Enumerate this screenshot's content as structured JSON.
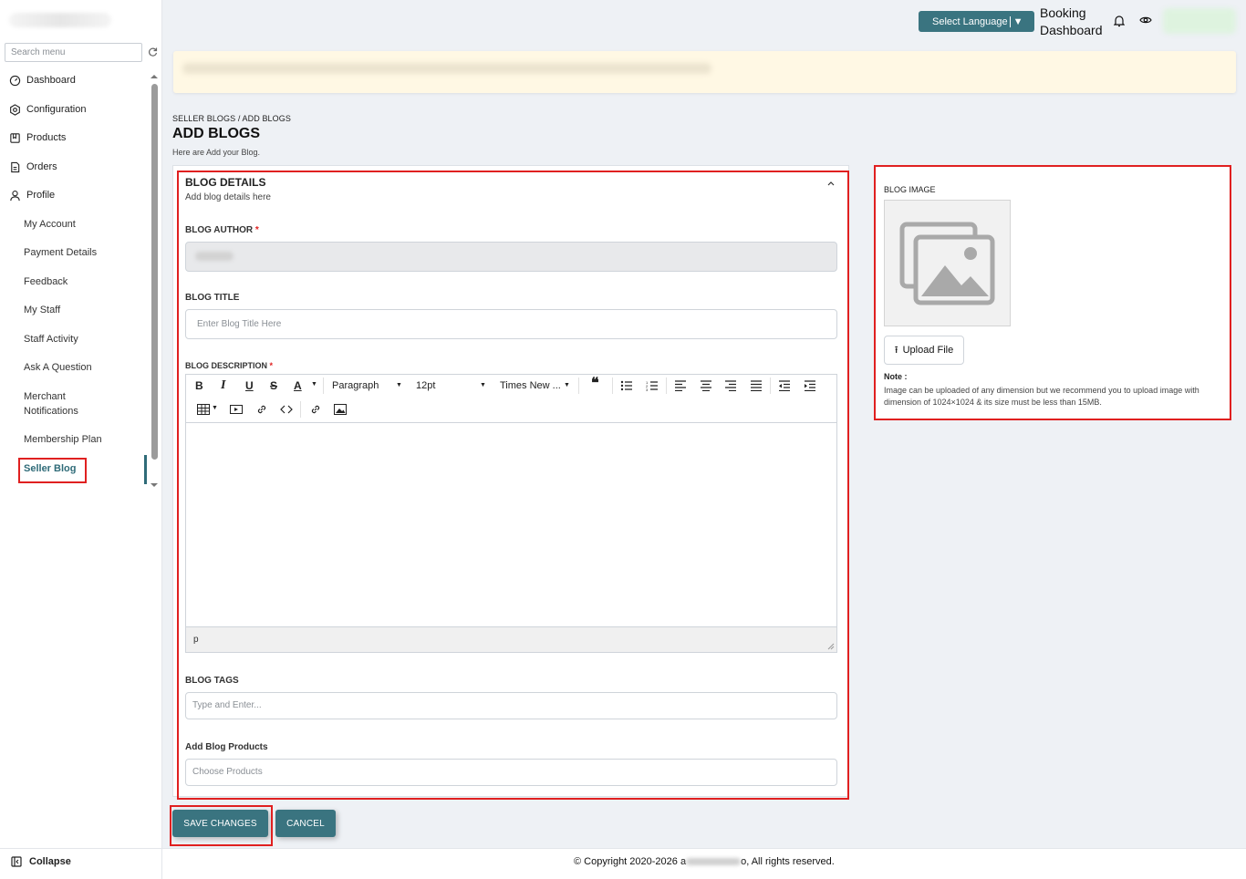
{
  "sidebar": {
    "search_placeholder": "Search menu",
    "items": [
      {
        "label": "Dashboard",
        "icon": "dashboard-icon"
      },
      {
        "label": "Configuration",
        "icon": "settings-hex-icon"
      },
      {
        "label": "Products",
        "icon": "products-icon"
      },
      {
        "label": "Orders",
        "icon": "orders-icon"
      },
      {
        "label": "Profile",
        "icon": "user-icon"
      }
    ],
    "profile_sub": [
      "My Account",
      "Payment Details",
      "Feedback",
      "My Staff",
      "Staff Activity",
      "Ask A Question",
      "Merchant Notifications",
      "Membership Plan",
      "Seller Blog"
    ],
    "collapse_label": "Collapse"
  },
  "header": {
    "language_label": "Select Language",
    "booking_dashboard": "Booking Dashboard"
  },
  "page": {
    "breadcrumb": "SELLER BLOGS / ADD BLOGS",
    "title": "ADD BLOGS",
    "subtitle": "Here are Add your Blog."
  },
  "details": {
    "title": "BLOG DETAILS",
    "subtitle": "Add blog details here",
    "author_label": "BLOG AUTHOR",
    "title_label": "BLOG TITLE",
    "title_placeholder": "Enter Blog Title Here",
    "description_label": "BLOG DESCRIPTION",
    "tags_label": "BLOG TAGS",
    "tags_placeholder": "Type and Enter...",
    "products_label": "Add Blog Products",
    "products_placeholder": "Choose Products",
    "required_mark": "*"
  },
  "editor": {
    "block_format": "Paragraph",
    "font_size": "12pt",
    "font_family": "Times New ...",
    "status_path": "p",
    "toolbar_row1": [
      "bold-icon",
      "italic-icon",
      "underline-icon",
      "strikethrough-icon",
      "text-color-icon",
      "blockquote-icon",
      "bullet-list-icon",
      "numbered-list-icon",
      "align-left-icon",
      "align-center-icon",
      "align-right-icon",
      "align-justify-icon",
      "outdent-icon",
      "indent-icon"
    ],
    "toolbar_row2": [
      "table-icon",
      "media-icon",
      "link-icon",
      "code-icon",
      "link-icon",
      "image-icon"
    ]
  },
  "image_panel": {
    "title": "BLOG IMAGE",
    "upload_label": "Upload File",
    "note_label": "Note :",
    "note_text": "Image can be uploaded of any dimension but we recommend you to upload image with dimension of 1024×1024 & its size must be less than 15MB."
  },
  "actions": {
    "save_label": "SAVE CHANGES",
    "cancel_label": "CANCEL"
  },
  "footer": {
    "copyright_prefix": "© Copyright 2020-2026 a",
    "copyright_suffix": "o, All rights reserved."
  },
  "colors": {
    "primary": "#3a7480",
    "highlight_box": "#e02020",
    "notice_bg": "#fff8e4"
  }
}
